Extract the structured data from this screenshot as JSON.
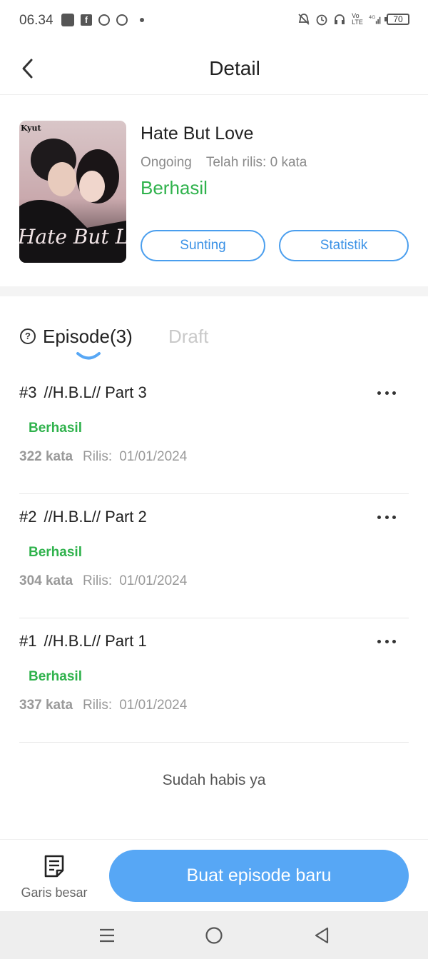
{
  "status_bar": {
    "time": "06.34",
    "battery": "70"
  },
  "header": {
    "title": "Detail",
    "back_icon": "chevron-left-icon"
  },
  "book": {
    "title": "Hate But Love",
    "state": "Ongoing",
    "released_words": "Telah rilis: 0 kata",
    "status": "Berhasil",
    "cover_text": "Kyut",
    "cover_script": "Hate But Love",
    "edit_label": "Sunting",
    "stats_label": "Statistik"
  },
  "tabs": {
    "help_icon": "question-circle-icon",
    "episode_label": "Episode(3)",
    "draft_label": "Draft",
    "active": "episode"
  },
  "episodes": [
    {
      "number": "#3",
      "title": "//H.B.L// Part 3",
      "status": "Berhasil",
      "words": "322 kata",
      "release_label": "Rilis:",
      "release_date": "01/01/2024"
    },
    {
      "number": "#2",
      "title": "//H.B.L// Part 2",
      "status": "Berhasil",
      "words": "304 kata",
      "release_label": "Rilis:",
      "release_date": "01/01/2024"
    },
    {
      "number": "#1",
      "title": "//H.B.L// Part 1",
      "status": "Berhasil",
      "words": "337 kata",
      "release_label": "Rilis:",
      "release_date": "01/01/2024"
    }
  ],
  "end_text": "Sudah habis ya",
  "bottom": {
    "outline_label": "Garis besar",
    "outline_icon": "document-lines-icon",
    "create_label": "Buat episode baru"
  },
  "colors": {
    "accent": "#57a7f5",
    "success": "#2fb24c",
    "muted": "#999999"
  }
}
